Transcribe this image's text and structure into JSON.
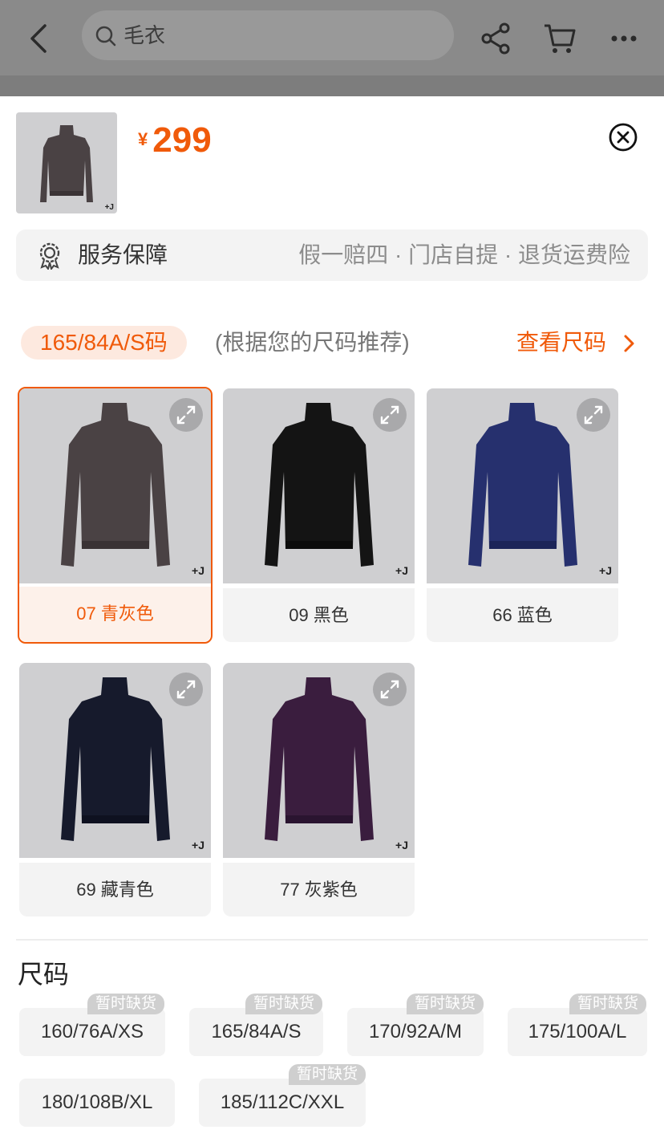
{
  "header": {
    "search_text": "毛衣",
    "icons": [
      "back-icon",
      "search-icon",
      "share-icon",
      "cart-icon",
      "more-icon"
    ]
  },
  "product": {
    "currency": "¥",
    "price": "299"
  },
  "service": {
    "label": "服务保障",
    "items": "假一赔四 · 门店自提 · 退货运费险"
  },
  "size_recommend": {
    "selected_size": "165/84A/S码",
    "hint": "(根据您的尺码推荐)",
    "link": "查看尺码"
  },
  "colors": [
    {
      "label": "07 青灰色",
      "selected": true,
      "color": "#4a4244"
    },
    {
      "label": "09 黑色",
      "selected": false,
      "color": "#141414"
    },
    {
      "label": "66 蓝色",
      "selected": false,
      "color": "#26306e"
    },
    {
      "label": "69 藏青色",
      "selected": false,
      "color": "#161a2c"
    },
    {
      "label": "77 灰紫色",
      "selected": false,
      "color": "#3a1d3e"
    }
  ],
  "brand_mark": "+J",
  "sizes_title": "尺码",
  "out_of_stock_label": "暂时缺货",
  "sizes": [
    {
      "label": "160/76A/XS",
      "out_of_stock": true
    },
    {
      "label": "165/84A/S",
      "out_of_stock": true
    },
    {
      "label": "170/92A/M",
      "out_of_stock": true
    },
    {
      "label": "175/100A/L",
      "out_of_stock": true
    },
    {
      "label": "180/108B/XL",
      "out_of_stock": false
    },
    {
      "label": "185/112C/XXL",
      "out_of_stock": true
    }
  ],
  "colors_theme": {
    "accent": "#f05a0a",
    "accent_soft": "#fde9df"
  }
}
